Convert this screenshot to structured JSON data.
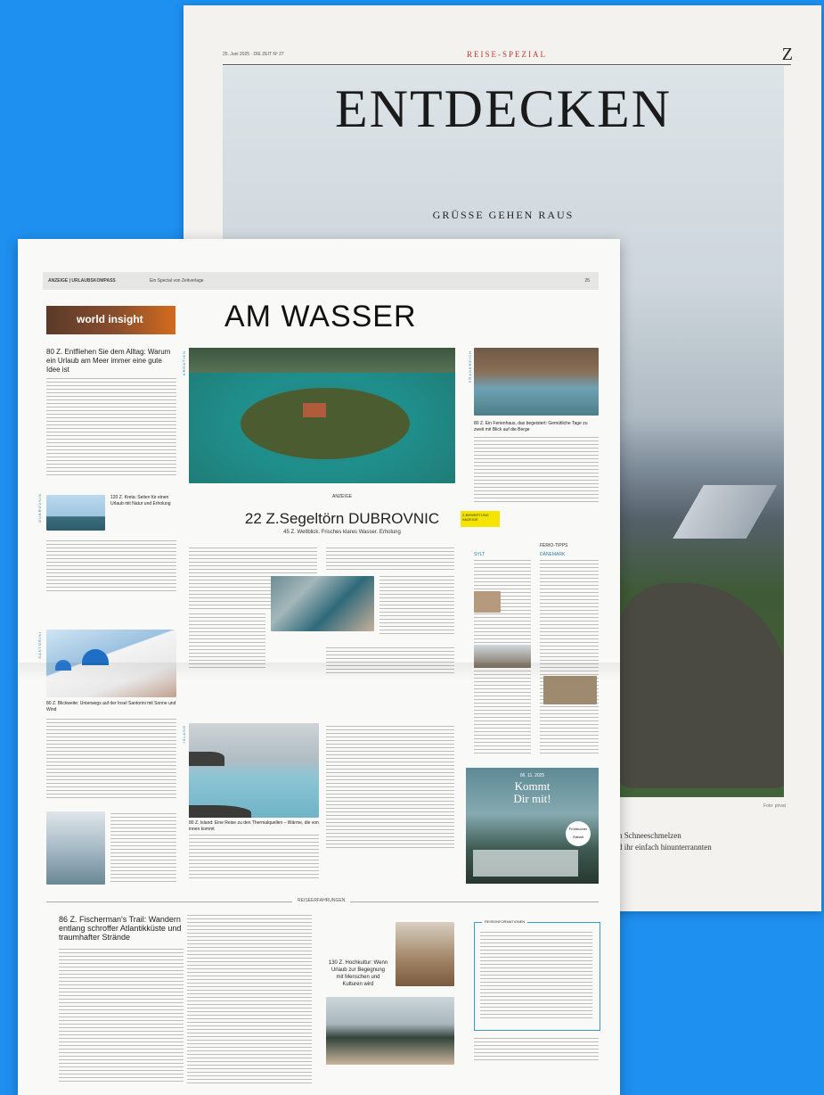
{
  "back_page": {
    "date_line": "25. Juni 2025 · DIE ZEIT Nº 27",
    "rubric": "REISE-SPEZIAL",
    "brand": "Z",
    "title": "ENTDECKEN",
    "subtitle": "GRÜSSE GEHEN RAUS",
    "photo_credit": "Foto: privat",
    "caption_lines": [
      "n Schneeschmelzen",
      "d ihr einfach hinunterrannten"
    ]
  },
  "front_page": {
    "topbar_left": "ANZEIGE | URLAUBSKOMPASS",
    "topbar_sep": "Ein Special von Zeitverlage",
    "topbar_right": "25",
    "logo_text": "world insight",
    "title": "AM WASSER",
    "left_article_headline": "80 Z. Entfliehen Sie dem Alltag: Warum ein Urlaub am Meer immer eine gute Idee ist",
    "side_labels": [
      "DUBROVNIK",
      "SANTORINI",
      "ISLAND",
      "KROATIEN",
      "FRANKREICH"
    ],
    "small_teaser_1": "120 Z. Kreta: Seiten für einen Urlaub mit Natur und Erholung",
    "santorini_headline": "80 Z. Blickweite: Unterwegs auf der Insel Santorini mit Sonne und Wind",
    "kicker": "ANZEIGE",
    "main_headline": "22 Z.Segeltörn DUBROVNIC",
    "main_subline": "45 Z. Weltblick. Frisches klares Wasser. Erholung",
    "right_article_headline": "80 Z. Ein Ferienhaus, das begeistert: Gemütliche Tage zu zweit mit Blick auf die Berge",
    "badge_text": "Z-BEWERTUNG ANZEIGE",
    "tipps_label": "FERIO-TIPPS",
    "tipps_cols": [
      "SYLT",
      "DÄNEMARK"
    ],
    "lagoon_caption": "80 Z. Island: Eine Reise zu den Thermalquellen – Wärme, die von innen kommt",
    "section_label": "REISEERFAHRUNGEN",
    "bottom_headline": "86 Z. Fischerman's Trail: Wandern entlang schroffer Atlantikküste und traumhafter Strände",
    "pull_quote": "130 Z. Hochkultur: Wenn Urlaub zur Begegnung mit Menschen und Kulturen wird",
    "infobox_title": "REISEINFORMATIONEN",
    "ad": {
      "date": "06. 11. 2025",
      "title_line1": "Kommt",
      "title_line2": "Dir mit!",
      "sticker": "Frühbucher Rabatt"
    }
  }
}
